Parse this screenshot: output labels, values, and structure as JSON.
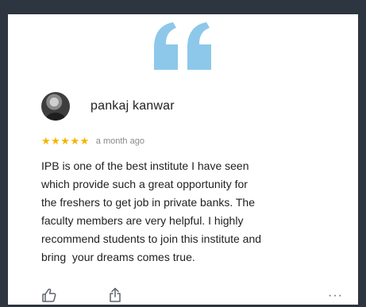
{
  "review": {
    "author": "pankaj kanwar",
    "rating_stars": "★★★★★",
    "rating": 5,
    "time": "a month ago",
    "text": "IPB is one of the best institute I have seen\nwhich provide such a great opportunity for\nthe freshers to get job in private banks. The\nfaculty members are very helpful. I highly\nrecommend students to join this institute and\nbring  your dreams comes true."
  },
  "actions": {
    "like_icon": "thumbs-up-icon",
    "share_icon": "share-icon",
    "more_label": "···"
  },
  "colors": {
    "background": "#2d3540",
    "quote": "#8dc8ea",
    "stars": "#f4b400"
  }
}
